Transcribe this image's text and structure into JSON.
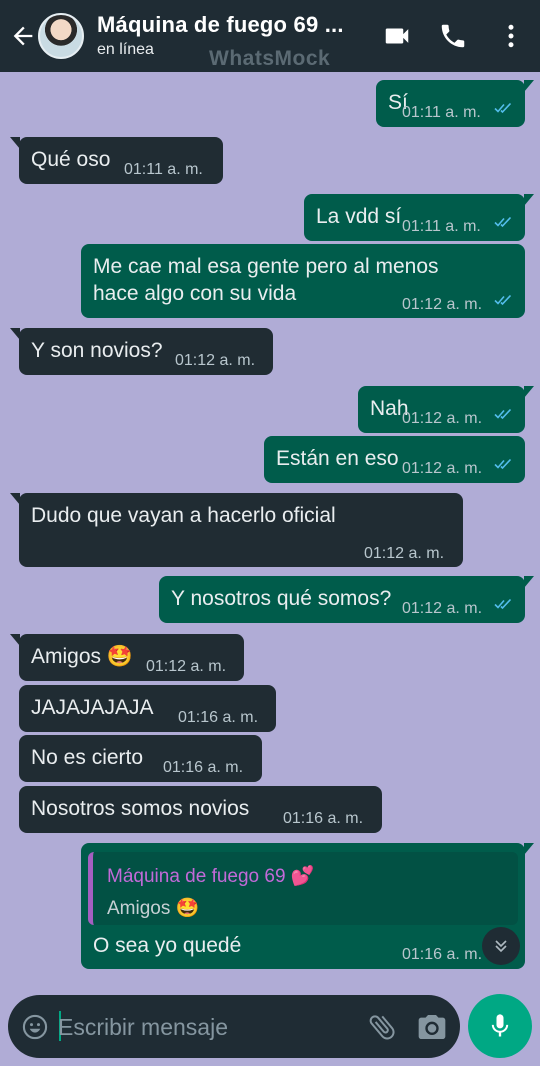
{
  "header": {
    "contact_name": "Máquina de fuego 69 ...",
    "status": "en línea",
    "watermark": "WhatsMock",
    "icons": [
      "back-arrow-icon",
      "video-call-icon",
      "phone-icon",
      "more-options-icon"
    ]
  },
  "messages": [
    {
      "dir": "out",
      "text": "Sí",
      "time": "01:11 a. m.",
      "read": true
    },
    {
      "dir": "in",
      "text": "Qué oso",
      "time": "01:11 a. m."
    },
    {
      "dir": "out",
      "text": "La vdd sí",
      "time": "01:11 a. m.",
      "read": true
    },
    {
      "dir": "out",
      "lines": [
        "Me cae mal esa gente pero al menos",
        "hace algo con su vida"
      ],
      "time": "01:12 a. m.",
      "read": true
    },
    {
      "dir": "in",
      "text": "Y son novios?",
      "time": "01:12 a. m."
    },
    {
      "dir": "out",
      "text": "Nah",
      "time": "01:12 a. m.",
      "read": true
    },
    {
      "dir": "out",
      "text": "Están en eso",
      "time": "01:12 a. m.",
      "read": true
    },
    {
      "dir": "in",
      "text": "Dudo que vayan a hacerlo oficial",
      "time": "01:12 a. m."
    },
    {
      "dir": "out",
      "text": "Y nosotros qué somos?",
      "time": "01:12 a. m.",
      "read": true
    },
    {
      "dir": "in",
      "text": "Amigos 🤩",
      "time": "01:12 a. m."
    },
    {
      "dir": "in",
      "text": "JAJAJAJAJA",
      "time": "01:16 a. m."
    },
    {
      "dir": "in",
      "text": "No es cierto",
      "time": "01:16 a. m."
    },
    {
      "dir": "in",
      "text": "Nosotros somos novios",
      "time": "01:16 a. m."
    },
    {
      "dir": "out",
      "quote": {
        "author": "Máquina de fuego 69 💕",
        "text": "Amigos 🤩"
      },
      "text": "O sea yo quedé",
      "time": "01:16 a. m."
    }
  ],
  "composer": {
    "placeholder": "Escribir mensaje",
    "icons": [
      "emoji-icon",
      "attach-icon",
      "camera-icon",
      "mic-icon"
    ]
  },
  "colors": {
    "background": "#b0acd6",
    "header": "#1f2c34",
    "incoming_bubble": "#202c33",
    "outgoing_bubble": "#005c4b",
    "accent": "#00a884",
    "read_ticks": "#53bdeb"
  }
}
